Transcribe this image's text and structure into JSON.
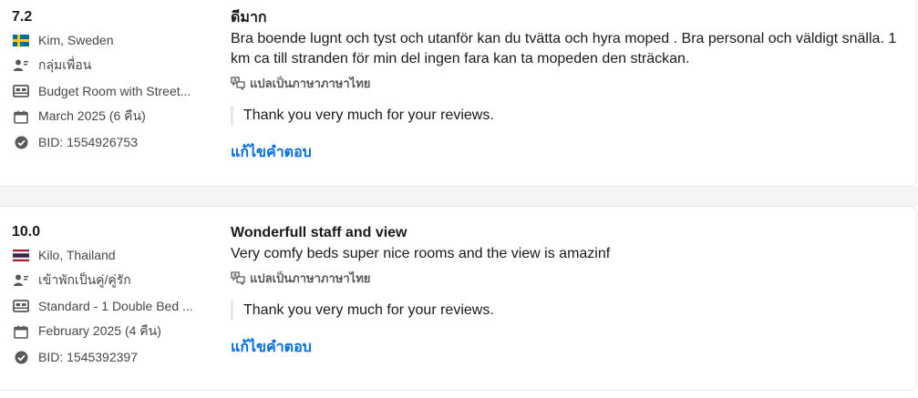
{
  "reviews": [
    {
      "score": "7.2",
      "reviewer": "Kim, Sweden",
      "country_flag": "sweden",
      "traveler_type": "กลุ่มเพื่อน",
      "room": "Budget Room with Street...",
      "stay": "March 2025 (6 คืน)",
      "booking_id": "BID: 1554926753",
      "title": "ดีมาก",
      "body": "Bra boende lugnt och tyst och utanför kan du tvätta och hyra moped . Bra personal och väldigt snälla. 1 km ca till stranden för min del ingen fara kan ta mopeden den sträckan.",
      "translate_label": "แปลเป็นภาษาภาษาไทย",
      "response": "Thank you very much for your reviews.",
      "edit_label": "แก้ไขคำตอบ"
    },
    {
      "score": "10.0",
      "reviewer": "Kilo, Thailand",
      "country_flag": "thailand",
      "traveler_type": "เข้าพักเป็นคู่/คู่รัก",
      "room": "Standard - 1 Double Bed ...",
      "stay": "February 2025 (4 คืน)",
      "booking_id": "BID: 1545392397",
      "title": "Wonderfull staff and view",
      "body": "Very comfy beds super nice rooms and the view is amazinf",
      "translate_label": "แปลเป็นภาษาภาษาไทย",
      "response": "Thank you very much for your reviews.",
      "edit_label": "แก้ไขคำตอบ"
    }
  ],
  "colors": {
    "link": "#006ce4",
    "meta_text": "#474747",
    "icon": "#595959"
  }
}
